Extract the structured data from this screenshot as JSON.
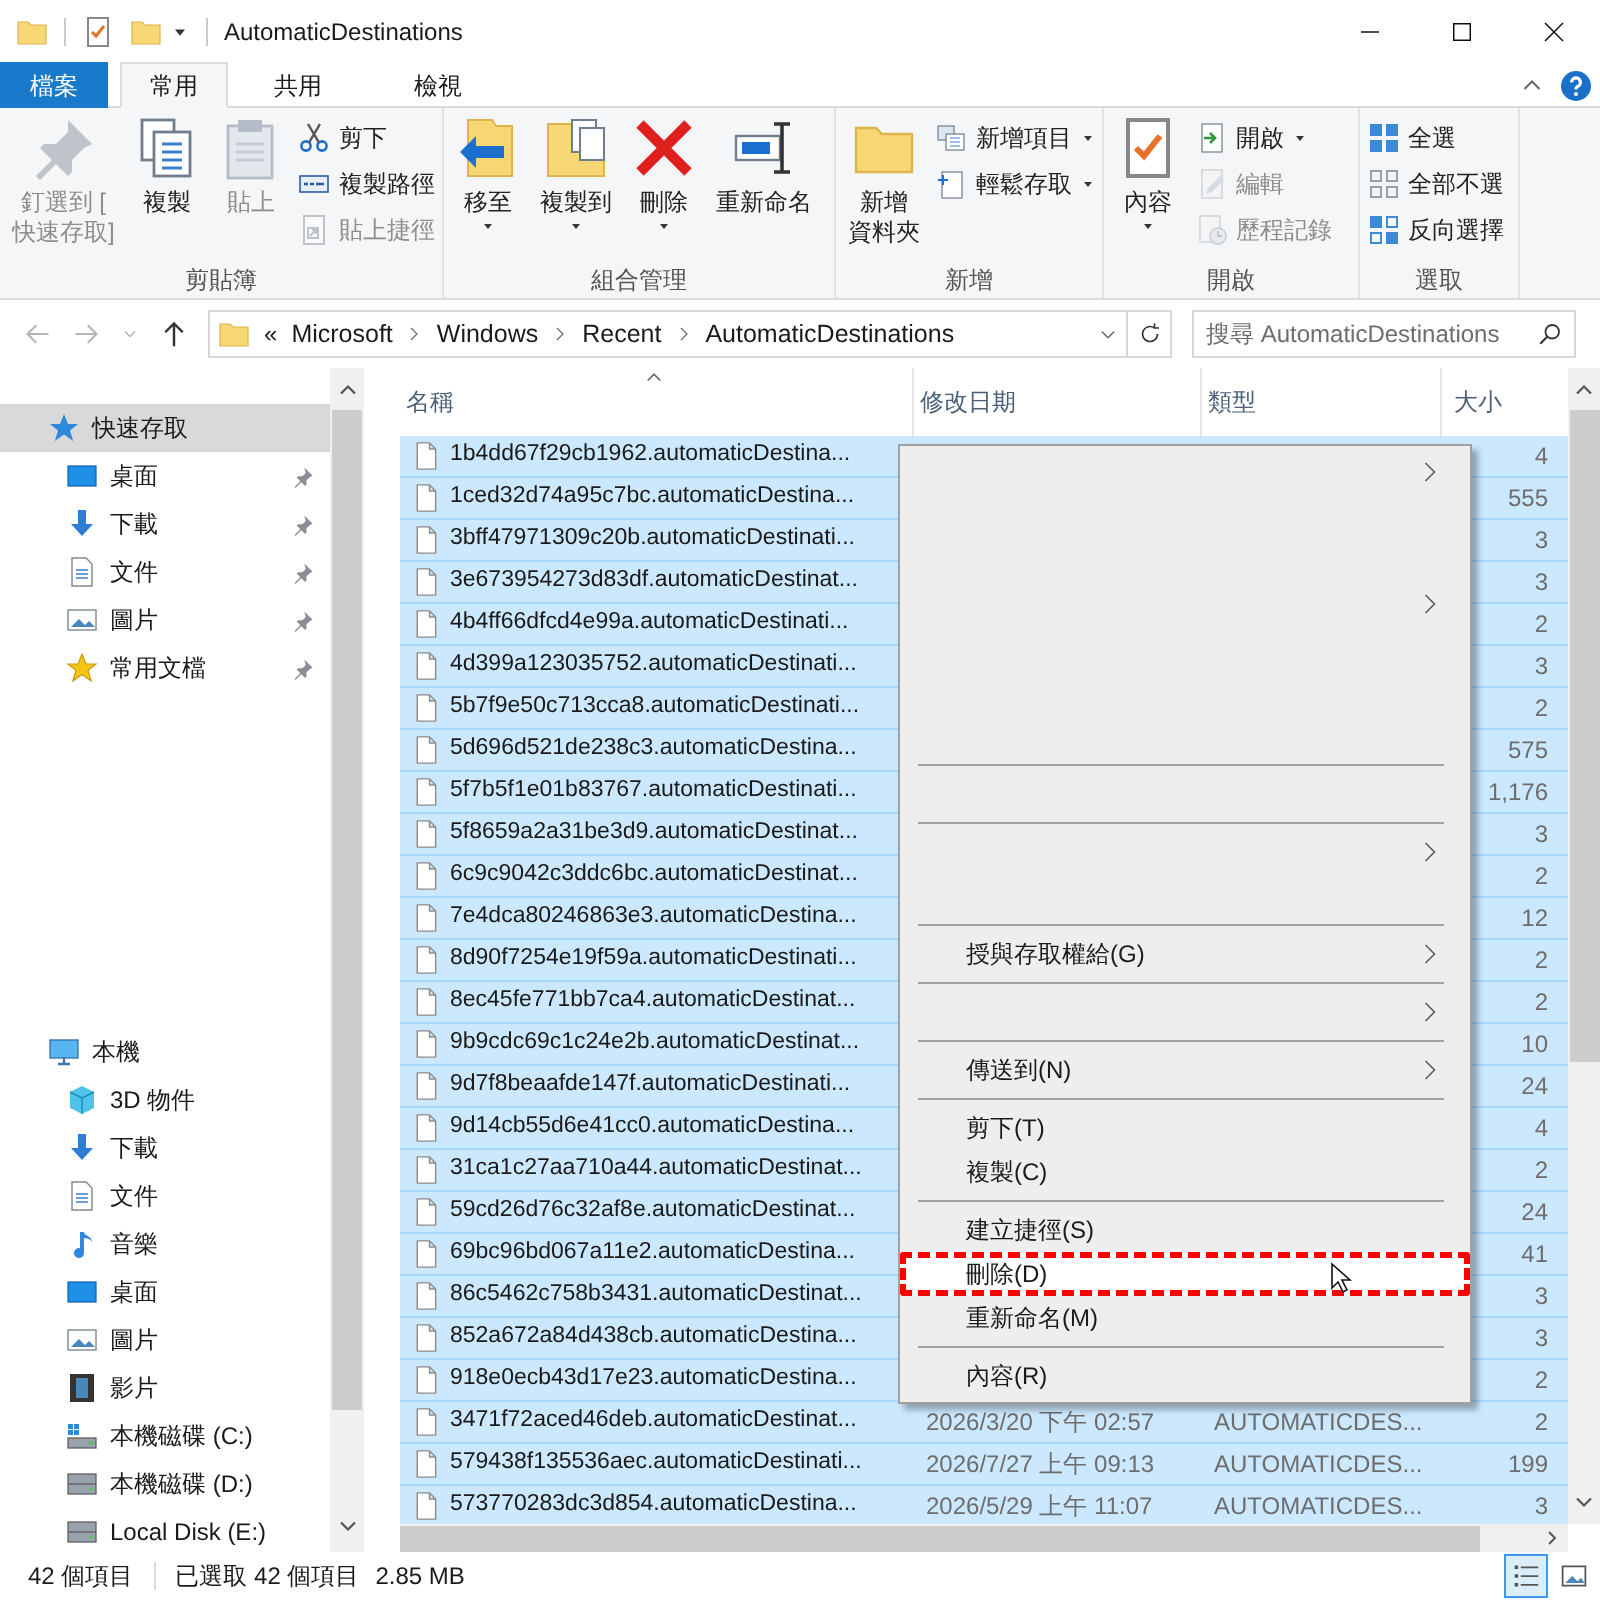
{
  "window": {
    "title": "AutomaticDestinations"
  },
  "ribbon_tabs": [
    {
      "label": "檔案",
      "kind": "file",
      "selected": false
    },
    {
      "label": "常用",
      "kind": "tab",
      "selected": true
    },
    {
      "label": "共用",
      "kind": "tab",
      "selected": false
    },
    {
      "label": "檢視",
      "kind": "tab",
      "selected": false
    }
  ],
  "ribbon_groups": [
    {
      "label": "剪貼簿",
      "buttons": [
        {
          "kind": "large",
          "label_lines": [
            "釘選到 [",
            "快速存取]"
          ],
          "disabled": true,
          "dropdown": false
        },
        {
          "kind": "large",
          "label": "複製",
          "disabled": false,
          "dropdown": false
        },
        {
          "kind": "large",
          "label": "貼上",
          "disabled": true,
          "dropdown": false
        },
        {
          "kind": "small",
          "label": "剪下",
          "disabled": false,
          "dropdown": false
        },
        {
          "kind": "small",
          "label": "複製路徑",
          "disabled": false,
          "dropdown": false
        },
        {
          "kind": "small",
          "label": "貼上捷徑",
          "disabled": true,
          "dropdown": false
        }
      ]
    },
    {
      "label": "組合管理",
      "buttons": [
        {
          "kind": "large",
          "label": "移至",
          "disabled": false,
          "dropdown": true
        },
        {
          "kind": "large",
          "label": "複製到",
          "disabled": false,
          "dropdown": true
        },
        {
          "kind": "large",
          "label": "刪除",
          "disabled": false,
          "dropdown": true
        },
        {
          "kind": "large",
          "label": "重新命名",
          "disabled": false,
          "dropdown": false
        }
      ]
    },
    {
      "label": "新增",
      "buttons": [
        {
          "kind": "large",
          "label_lines": [
            "新增",
            "資料夾"
          ],
          "disabled": false,
          "dropdown": false
        },
        {
          "kind": "small",
          "label": "新增項目",
          "disabled": false,
          "dropdown": true
        },
        {
          "kind": "small",
          "label": "輕鬆存取",
          "disabled": false,
          "dropdown": true
        }
      ]
    },
    {
      "label": "開啟",
      "buttons": [
        {
          "kind": "large",
          "label": "內容",
          "disabled": false,
          "dropdown": true
        },
        {
          "kind": "small",
          "label": "開啟",
          "disabled": false,
          "dropdown": true
        },
        {
          "kind": "small",
          "label": "編輯",
          "disabled": true,
          "dropdown": false
        },
        {
          "kind": "small",
          "label": "歷程記錄",
          "disabled": true,
          "dropdown": false
        }
      ]
    },
    {
      "label": "選取",
      "buttons": [
        {
          "kind": "small",
          "label": "全選",
          "disabled": false,
          "dropdown": false
        },
        {
          "kind": "small",
          "label": "全部不選",
          "disabled": false,
          "dropdown": false
        },
        {
          "kind": "small",
          "label": "反向選擇",
          "disabled": false,
          "dropdown": false
        }
      ]
    }
  ],
  "address": {
    "overflow": "«",
    "path": [
      "Microsoft",
      "Windows",
      "Recent",
      "AutomaticDestinations"
    ]
  },
  "search": {
    "placeholder": "搜尋 AutomaticDestinations"
  },
  "sidebar": {
    "groups": [
      {
        "label": "快速存取",
        "selected": true,
        "children": [
          {
            "label": "桌面",
            "pinned": true,
            "selected": false
          },
          {
            "label": "下載",
            "pinned": true,
            "selected": false
          },
          {
            "label": "文件",
            "pinned": true,
            "selected": false
          },
          {
            "label": "圖片",
            "pinned": true,
            "selected": false
          },
          {
            "label": "常用文檔",
            "pinned": true,
            "selected": false
          }
        ]
      },
      {
        "label": "本機",
        "selected": false,
        "children": [
          {
            "label": "3D 物件",
            "pinned": false,
            "selected": false
          },
          {
            "label": "下載",
            "pinned": false,
            "selected": false
          },
          {
            "label": "文件",
            "pinned": false,
            "selected": false
          },
          {
            "label": "音樂",
            "pinned": false,
            "selected": false
          },
          {
            "label": "桌面",
            "pinned": false,
            "selected": false
          },
          {
            "label": "圖片",
            "pinned": false,
            "selected": false
          },
          {
            "label": "影片",
            "pinned": false,
            "selected": false
          },
          {
            "label": "本機磁碟 (C:)",
            "pinned": false,
            "selected": false
          },
          {
            "label": "本機磁碟 (D:)",
            "pinned": false,
            "selected": false
          },
          {
            "label": "Local Disk (E:)",
            "pinned": false,
            "selected": false
          }
        ]
      }
    ]
  },
  "file_list": {
    "columns": [
      "名稱",
      "修改日期",
      "類型",
      "大小"
    ],
    "rows": [
      {
        "name": "1b4dd67f29cb1962.automaticDestina...",
        "size": "4",
        "selected": true
      },
      {
        "name": "1ced32d74a95c7bc.automaticDestina...",
        "size": "555",
        "selected": true
      },
      {
        "name": "3bff47971309c20b.automaticDestinati...",
        "size": "3",
        "selected": true
      },
      {
        "name": "3e673954273d83df.automaticDestinat...",
        "size": "3",
        "selected": true
      },
      {
        "name": "4b4ff66dfcd4e99a.automaticDestinati...",
        "size": "2",
        "selected": true
      },
      {
        "name": "4d399a123035752.automaticDestinati...",
        "size": "3",
        "selected": true
      },
      {
        "name": "5b7f9e50c713cca8.automaticDestinati...",
        "size": "2",
        "selected": true
      },
      {
        "name": "5d696d521de238c3.automaticDestina...",
        "size": "575",
        "selected": true
      },
      {
        "name": "5f7b5f1e01b83767.automaticDestinati...",
        "size": "1,176",
        "selected": true
      },
      {
        "name": "5f8659a2a31be3d9.automaticDestinat...",
        "size": "3",
        "selected": true
      },
      {
        "name": "6c9c9042c3ddc6bc.automaticDestinat...",
        "size": "2",
        "selected": true
      },
      {
        "name": "7e4dca80246863e3.automaticDestina...",
        "size": "12",
        "selected": true
      },
      {
        "name": "8d90f7254e19f59a.automaticDestinati...",
        "size": "2",
        "selected": true
      },
      {
        "name": "8ec45fe771bb7ca4.automaticDestinat...",
        "size": "2",
        "selected": true
      },
      {
        "name": "9b9cdc69c1c24e2b.automaticDestinat...",
        "size": "10",
        "selected": true
      },
      {
        "name": "9d7f8beaafde147f.automaticDestinati...",
        "size": "24",
        "selected": true
      },
      {
        "name": "9d14cb55d6e41cc0.automaticDestina...",
        "size": "4",
        "selected": true
      },
      {
        "name": "31ca1c27aa710a44.automaticDestinat...",
        "size": "2",
        "selected": true
      },
      {
        "name": "59cd26d76c32af8e.automaticDestinat...",
        "size": "24",
        "selected": true
      },
      {
        "name": "69bc96bd067a11e2.automaticDestina...",
        "size": "41",
        "selected": true
      },
      {
        "name": "86c5462c758b3431.automaticDestinat...",
        "size": "3",
        "selected": true
      },
      {
        "name": "852a672a84d438cb.automaticDestina...",
        "size": "3",
        "selected": true
      },
      {
        "name": "918e0ecb43d17e23.automaticDestina...",
        "size": "2",
        "selected": true
      },
      {
        "name": "3471f72aced46deb.automaticDestinat...",
        "modified": "2026/3/20 下午 02:57",
        "type": "AUTOMATICDES...",
        "size": "2",
        "selected": true
      },
      {
        "name": "579438f135536aec.automaticDestinati...",
        "modified": "2026/7/27 上午 09:13",
        "type": "AUTOMATICDES...",
        "size": "199",
        "selected": true
      },
      {
        "name": "573770283dc3d854.automaticDestina...",
        "modified": "2026/5/29 上午 11:07",
        "type": "AUTOMATICDES...",
        "size": "3",
        "selected": true
      }
    ]
  },
  "context_menu": {
    "items": [
      {
        "kind": "submenu"
      },
      {
        "kind": "blank"
      },
      {
        "kind": "blank"
      },
      {
        "kind": "submenu"
      },
      {
        "kind": "blank"
      },
      {
        "kind": "blank"
      },
      {
        "kind": "blank"
      },
      {
        "kind": "separator"
      },
      {
        "kind": "blank"
      },
      {
        "kind": "separator"
      },
      {
        "kind": "submenu"
      },
      {
        "kind": "blank"
      },
      {
        "kind": "separator"
      },
      {
        "kind": "submenu",
        "label": "授與存取權給(G)",
        "selected": false
      },
      {
        "kind": "separator"
      },
      {
        "kind": "submenu"
      },
      {
        "kind": "separator"
      },
      {
        "kind": "submenu",
        "label": "傳送到(N)",
        "selected": false
      },
      {
        "kind": "separator"
      },
      {
        "kind": "item",
        "label": "剪下(T)",
        "selected": false
      },
      {
        "kind": "item",
        "label": "複製(C)",
        "selected": false
      },
      {
        "kind": "separator"
      },
      {
        "kind": "item",
        "label": "建立捷徑(S)",
        "selected": false
      },
      {
        "kind": "item",
        "label": "刪除(D)",
        "selected": true
      },
      {
        "kind": "item",
        "label": "重新命名(M)",
        "selected": false
      },
      {
        "kind": "separator"
      },
      {
        "kind": "item",
        "label": "內容(R)",
        "selected": false
      }
    ]
  },
  "status_bar": {
    "item_count": "42 個項目",
    "selection": "已選取 42 個項目",
    "selection_size": "2.85 MB",
    "view_buttons": [
      {
        "selected": true
      },
      {
        "selected": false
      }
    ]
  }
}
